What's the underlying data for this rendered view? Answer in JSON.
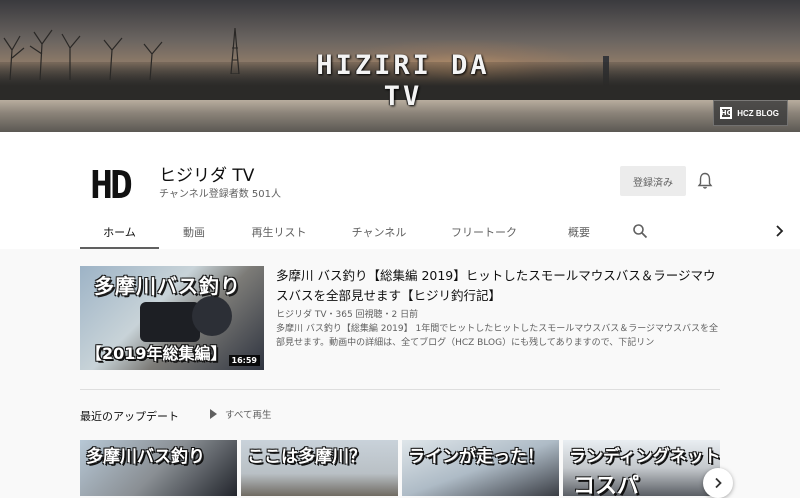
{
  "banner": {
    "title": "HIZIRI DA TV",
    "link_label": "HCZ BLOG",
    "link_logo": "HC"
  },
  "channel": {
    "avatar_text": "HD",
    "name": "ヒジリダ TV",
    "subscribers": "チャンネル登録者数 501人",
    "subscribe_label": "登録済み"
  },
  "tabs": [
    {
      "label": "ホーム",
      "active": true
    },
    {
      "label": "動画"
    },
    {
      "label": "再生リスト"
    },
    {
      "label": "チャンネル"
    },
    {
      "label": "フリートーク"
    },
    {
      "label": "概要"
    }
  ],
  "featured": {
    "thumb_line1": "多摩川バス釣り",
    "thumb_line2": "【2019年総集編】",
    "duration": "16:59",
    "title": "多摩川 バス釣り【総集編 2019】ヒットしたスモールマウスバス＆ラージマウスバスを全部見せます【ヒジリ釣行記】",
    "meta": "ヒジリダ TV・365 回視聴・2 日前",
    "description": "多摩川 バス釣り【総集編 2019】 1年間でヒットしたヒットしたスモールマウスバス＆ラージマウスバスを全部見せます。動画中の詳細は、全てブログ（HCZ BLOG）にも残してありますので、下記リン"
  },
  "uploads": {
    "section_title": "最近のアップデート",
    "play_all_label": "すべて再生",
    "items": [
      {
        "caption": "多摩川バス釣り"
      },
      {
        "caption": "ここは多摩川？"
      },
      {
        "caption": "ラインが走った！"
      },
      {
        "caption": "ランディングネット",
        "caption2": "コスパ"
      }
    ]
  },
  "icons": {
    "bell": "bell-icon",
    "search": "search-icon",
    "tabs_next": "chevron-right-icon",
    "row_next": "chevron-right-icon",
    "play": "play-icon"
  }
}
